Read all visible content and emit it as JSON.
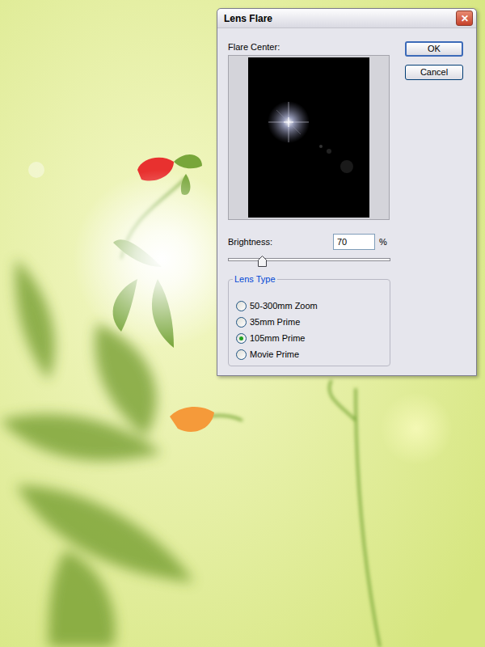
{
  "window": {
    "title": "Lens Flare",
    "close": "✕"
  },
  "buttons": [
    {
      "label": "OK",
      "default": true
    },
    {
      "label": "Cancel",
      "default": false
    }
  ],
  "preview": {
    "label": "Flare Center:"
  },
  "brightness": {
    "label": "Brightness:",
    "value": "70",
    "unit": "%",
    "level": 0.21
  },
  "lens_type": {
    "label": "Lens Type",
    "options": [
      {
        "label": "50-300mm Zoom",
        "selected": false
      },
      {
        "label": "35mm Prime",
        "selected": false
      },
      {
        "label": "105mm Prime",
        "selected": true
      },
      {
        "label": "Movie Prime",
        "selected": false
      }
    ]
  }
}
